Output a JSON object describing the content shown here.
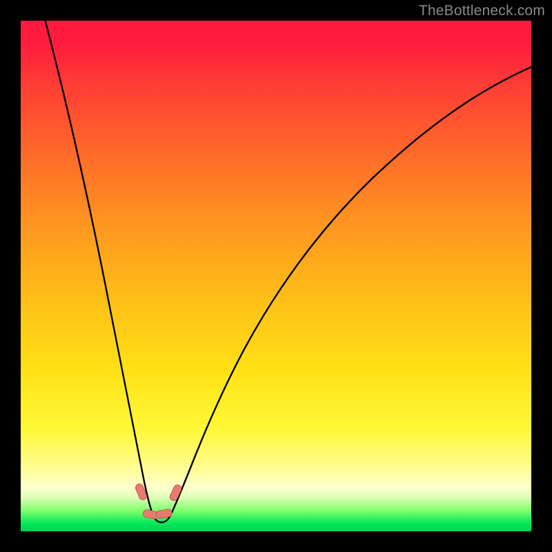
{
  "watermark": "TheBottleneck.com",
  "colors": {
    "background": "#000000",
    "curve_stroke": "#000000",
    "marker_fill": "#e77b70",
    "marker_stroke": "#c95a50"
  },
  "chart_data": {
    "type": "line",
    "title": "",
    "xlabel": "",
    "ylabel": "",
    "xlim": [
      0,
      100
    ],
    "ylim": [
      0,
      100
    ],
    "description": "Bottleneck percentage curve. Minimum (0%) around x≈26; left branch rises steeply to ~100% as x→0; right branch rises gradually to ~80% as x→100.",
    "x": [
      0,
      2,
      4,
      6,
      8,
      10,
      12,
      14,
      16,
      18,
      20,
      22,
      24,
      25,
      26,
      27,
      28,
      29,
      30,
      32,
      34,
      38,
      42,
      46,
      50,
      55,
      60,
      65,
      70,
      75,
      80,
      85,
      90,
      95,
      100
    ],
    "values": [
      110,
      100,
      90,
      80,
      70,
      61,
      52,
      44,
      36,
      28,
      21,
      14,
      7,
      3,
      0,
      0,
      2,
      5,
      8,
      14,
      19,
      28,
      35,
      42,
      48,
      54,
      59,
      63,
      67,
      70,
      73,
      75,
      77,
      79,
      80
    ],
    "markers": [
      {
        "x": 22.5,
        "y": 5.5
      },
      {
        "x": 24.0,
        "y": 1.8
      },
      {
        "x": 27.0,
        "y": 1.8
      },
      {
        "x": 29.0,
        "y": 5.5
      }
    ]
  }
}
